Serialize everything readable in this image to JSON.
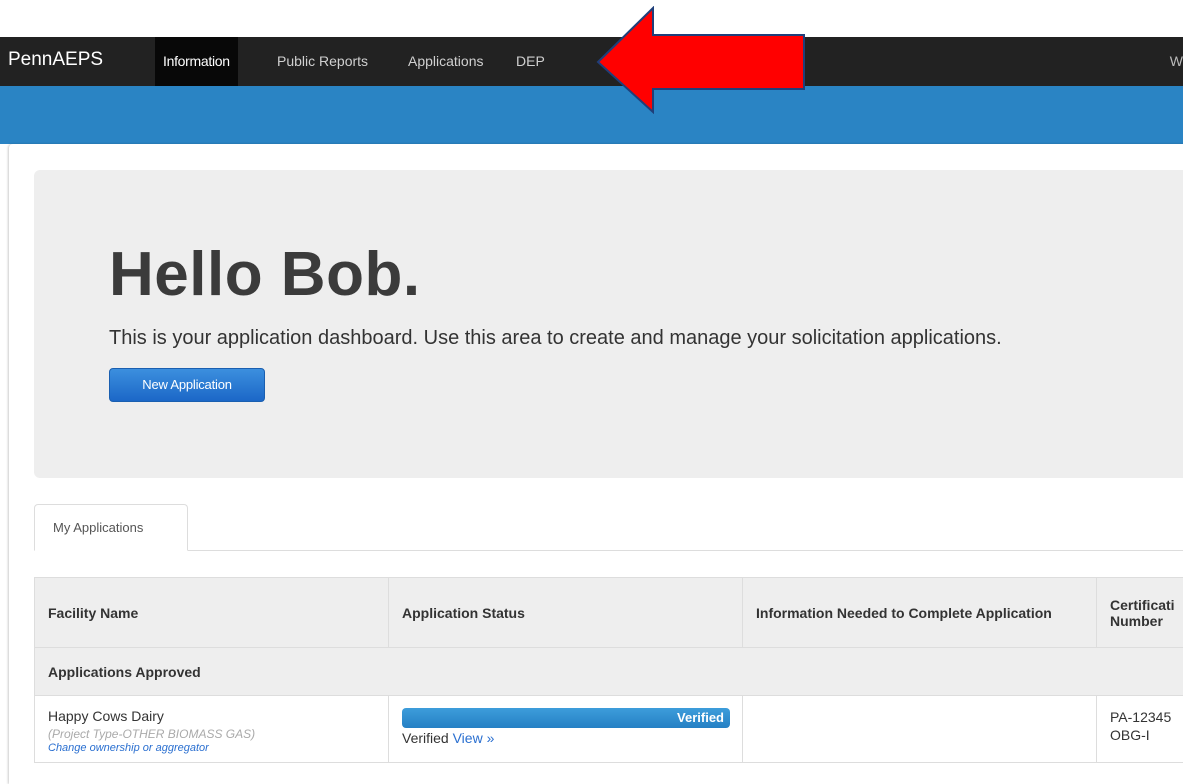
{
  "navbar": {
    "brand": "PennAEPS",
    "items": [
      {
        "label": "Information"
      },
      {
        "label": "Public Reports"
      },
      {
        "label": "Applications"
      },
      {
        "label": "DEP"
      }
    ],
    "right_label": "W"
  },
  "jumbotron": {
    "heading": "Hello Bob.",
    "lead": "This is your application dashboard. Use this area to create and manage your solicitation applications.",
    "new_button": "New Application"
  },
  "tabs": [
    {
      "label": "My Applications"
    }
  ],
  "table": {
    "headers": [
      "Facility Name",
      "Application Status",
      "Information Needed to Complete Application",
      "Certificati Number"
    ],
    "section_label": "Applications Approved",
    "rows": [
      {
        "facility_name": "Happy Cows Dairy",
        "project_type": "(Project Type-OTHER BIOMASS GAS)",
        "change_link": "Change ownership or aggregator",
        "progress_label": "Verified",
        "progress_percent": 100,
        "status_text": "Verified",
        "view_link": "View »",
        "info_needed": "",
        "cert_line1": "PA-12345",
        "cert_line2": "OBG-I"
      }
    ]
  },
  "colors": {
    "navbar": "#222222",
    "blue_band": "#2a84c4",
    "arrow": "#ff0000"
  },
  "icons": [
    "red-arrow-annotation"
  ]
}
